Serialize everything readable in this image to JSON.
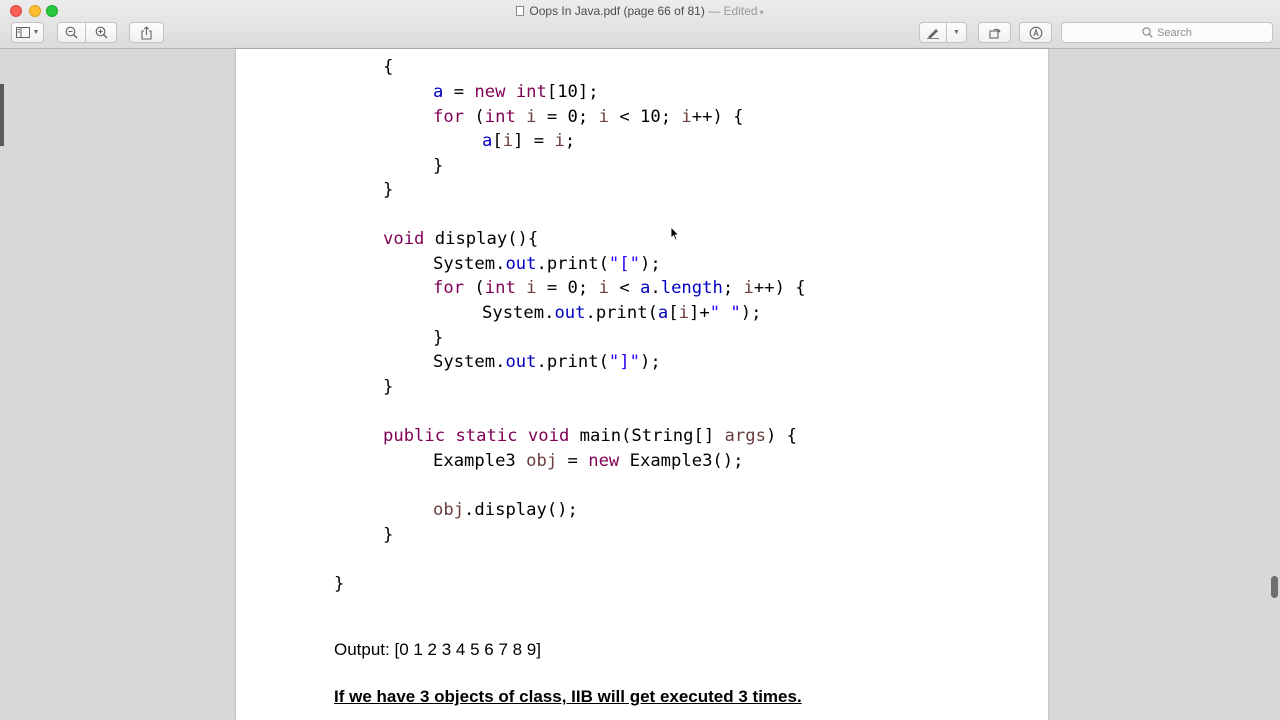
{
  "window": {
    "title": "Oops In Java.pdf (page 66 of 81)",
    "status": "— Edited",
    "search_placeholder": "Search"
  },
  "toolbar": {
    "icons": [
      "sidebar-icon",
      "chevron-down-icon",
      "zoom-out-icon",
      "zoom-in-icon",
      "share-icon",
      "pen-markup-icon",
      "rotate-icon",
      "annotate-icon",
      "search-icon"
    ]
  },
  "document": {
    "code_lines": [
      [
        {
          "t": "{",
          "c": ""
        }
      ],
      [
        {
          "t": "a",
          "c": "fld"
        },
        {
          "t": " = ",
          "c": ""
        },
        {
          "t": "new",
          "c": "kw"
        },
        {
          "t": " ",
          "c": ""
        },
        {
          "t": "int",
          "c": "kw"
        },
        {
          "t": "[10];",
          "c": ""
        }
      ],
      [
        {
          "t": "for",
          "c": "kw"
        },
        {
          "t": " (",
          "c": ""
        },
        {
          "t": "int",
          "c": "kw"
        },
        {
          "t": " ",
          "c": ""
        },
        {
          "t": "i",
          "c": "var"
        },
        {
          "t": " = 0; ",
          "c": ""
        },
        {
          "t": "i",
          "c": "var"
        },
        {
          "t": " < 10; ",
          "c": ""
        },
        {
          "t": "i",
          "c": "var"
        },
        {
          "t": "++) {",
          "c": ""
        }
      ],
      [
        {
          "t": "a",
          "c": "fld"
        },
        {
          "t": "[",
          "c": ""
        },
        {
          "t": "i",
          "c": "var"
        },
        {
          "t": "] = ",
          "c": ""
        },
        {
          "t": "i",
          "c": "var"
        },
        {
          "t": ";",
          "c": ""
        }
      ],
      [
        {
          "t": "}",
          "c": ""
        }
      ],
      [
        {
          "t": "}",
          "c": ""
        }
      ],
      [
        {
          "t": "void",
          "c": "kw"
        },
        {
          "t": " display(){",
          "c": ""
        }
      ],
      [
        {
          "t": "System.",
          "c": ""
        },
        {
          "t": "out",
          "c": "fld"
        },
        {
          "t": ".print(",
          "c": ""
        },
        {
          "t": "\"[\"",
          "c": "str"
        },
        {
          "t": ");",
          "c": ""
        }
      ],
      [
        {
          "t": "for",
          "c": "kw"
        },
        {
          "t": " (",
          "c": ""
        },
        {
          "t": "int",
          "c": "kw"
        },
        {
          "t": " ",
          "c": ""
        },
        {
          "t": "i",
          "c": "var"
        },
        {
          "t": " = 0; ",
          "c": ""
        },
        {
          "t": "i",
          "c": "var"
        },
        {
          "t": " < ",
          "c": ""
        },
        {
          "t": "a",
          "c": "fld"
        },
        {
          "t": ".",
          "c": ""
        },
        {
          "t": "length",
          "c": "fld"
        },
        {
          "t": "; ",
          "c": ""
        },
        {
          "t": "i",
          "c": "var"
        },
        {
          "t": "++) {",
          "c": ""
        }
      ],
      [
        {
          "t": "System.",
          "c": ""
        },
        {
          "t": "out",
          "c": "fld"
        },
        {
          "t": ".print(",
          "c": ""
        },
        {
          "t": "a",
          "c": "fld"
        },
        {
          "t": "[",
          "c": ""
        },
        {
          "t": "i",
          "c": "var"
        },
        {
          "t": "]+",
          "c": ""
        },
        {
          "t": "\" \"",
          "c": "str"
        },
        {
          "t": ");",
          "c": ""
        }
      ],
      [
        {
          "t": "}",
          "c": ""
        }
      ],
      [
        {
          "t": "System.",
          "c": ""
        },
        {
          "t": "out",
          "c": "fld"
        },
        {
          "t": ".print(",
          "c": ""
        },
        {
          "t": "\"]\"",
          "c": "str"
        },
        {
          "t": ");",
          "c": ""
        }
      ],
      [
        {
          "t": "}",
          "c": ""
        }
      ],
      [
        {
          "t": "public",
          "c": "kw"
        },
        {
          "t": " ",
          "c": ""
        },
        {
          "t": "static",
          "c": "kw"
        },
        {
          "t": " ",
          "c": ""
        },
        {
          "t": "void",
          "c": "kw"
        },
        {
          "t": " main(String[] ",
          "c": ""
        },
        {
          "t": "args",
          "c": "var"
        },
        {
          "t": ") {",
          "c": ""
        }
      ],
      [
        {
          "t": "Example3 ",
          "c": ""
        },
        {
          "t": "obj",
          "c": "var"
        },
        {
          "t": " = ",
          "c": ""
        },
        {
          "t": "new",
          "c": "kw"
        },
        {
          "t": " Example3();",
          "c": ""
        }
      ],
      [
        {
          "t": "obj",
          "c": "var"
        },
        {
          "t": ".display();",
          "c": ""
        }
      ],
      [
        {
          "t": "}",
          "c": ""
        }
      ],
      [
        {
          "t": "}",
          "c": ""
        }
      ]
    ],
    "output_line": "Output: [0 1 2 3 4 5 6 7 8 9]",
    "note_line": "If we have 3 objects of class, IIB will get executed 3 times."
  }
}
